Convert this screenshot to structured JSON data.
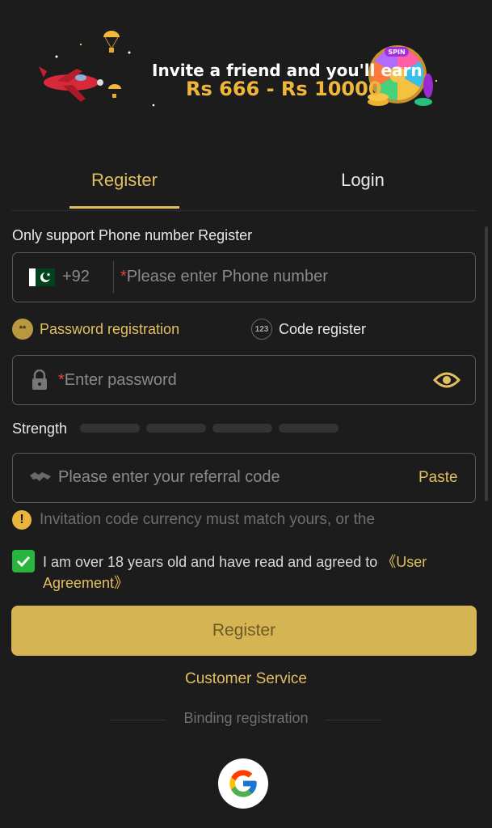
{
  "banner": {
    "line1": "Invite a friend and you'll earn",
    "line2": "Rs 666 - Rs 10000",
    "wheel_text": "SPIN"
  },
  "tabs": [
    {
      "label": "Register",
      "active": true
    },
    {
      "label": "Login",
      "active": false
    }
  ],
  "phone": {
    "label": "Only support Phone number Register",
    "country_code": "+92",
    "required_mark": "*",
    "placeholder": "Please enter Phone number",
    "flag_icon": "pakistan-flag-icon"
  },
  "reg_options": [
    {
      "label": "Password registration",
      "icon_text": "**",
      "selected": true
    },
    {
      "label": "Code register",
      "icon_text": "123",
      "selected": false
    }
  ],
  "password": {
    "required_mark": "*",
    "placeholder": "Enter password",
    "lock_icon": "lock-icon",
    "eye_icon": "eye-icon"
  },
  "strength": {
    "label": "Strength",
    "level": 0,
    "segments": 4
  },
  "referral": {
    "placeholder": "Please enter your referral code",
    "paste_label": "Paste",
    "icon": "handshake-icon"
  },
  "warning": {
    "text": "Invitation code currency must match yours, or the"
  },
  "agreement": {
    "checked": true,
    "text": "I am over 18 years old and have read and agreed to ",
    "link": "《User Agreement》"
  },
  "register_button": "Register",
  "customer_service": "Customer Service",
  "binding": {
    "label": "Binding registration",
    "google_icon": "google-icon"
  },
  "colors": {
    "accent": "#e4bf5f",
    "background": "#1c1c1c",
    "button": "#d5b453",
    "checkbox": "#28b43e",
    "required": "#e0443a"
  }
}
